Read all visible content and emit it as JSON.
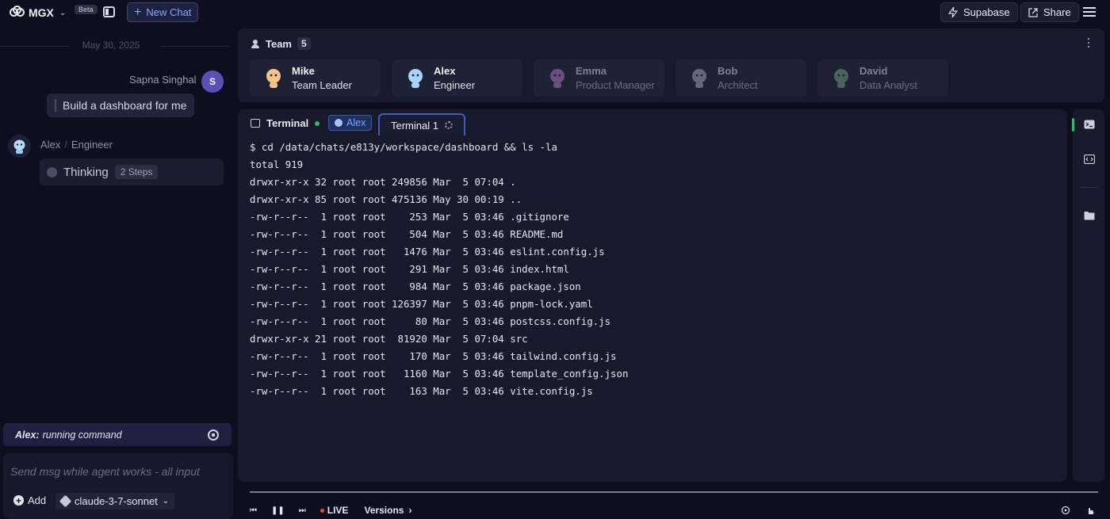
{
  "app": {
    "logo_text": "MGX",
    "beta_label": "Beta",
    "new_chat_label": "New Chat",
    "supabase_label": "Supabase",
    "share_label": "Share"
  },
  "chat": {
    "date": "May 30, 2025",
    "user": {
      "name": "Sapna Singhal",
      "avatar_initial": "S",
      "message": "Build a dashboard for me"
    },
    "agent": {
      "name": "Alex",
      "role": "Engineer",
      "thinking_label": "Thinking",
      "steps_label": "2 Steps"
    },
    "status": {
      "agent": "Alex:",
      "text": "running command"
    },
    "input": {
      "placeholder": "Send msg while agent works - all input",
      "add_label": "Add",
      "model": "claude-3-7-sonnet"
    }
  },
  "team": {
    "title": "Team",
    "count": "5",
    "members": [
      {
        "name": "Mike",
        "role": "Team Leader",
        "active": true,
        "avatar_color": "#f4c48a"
      },
      {
        "name": "Alex",
        "role": "Engineer",
        "active": true,
        "avatar_color": "#a8d4ff"
      },
      {
        "name": "Emma",
        "role": "Product Manager",
        "active": false,
        "avatar_color": "#c58ad8"
      },
      {
        "name": "Bob",
        "role": "Architect",
        "active": false,
        "avatar_color": "#b9bccc"
      },
      {
        "name": "David",
        "role": "Data Analyst",
        "active": false,
        "avatar_color": "#7fb68f"
      }
    ]
  },
  "terminal": {
    "label": "Terminal",
    "agent_chip": "Alex",
    "tab_label": "Terminal 1",
    "lines": [
      "$ cd /data/chats/e813y/workspace/dashboard && ls -la",
      "total 919",
      "drwxr-xr-x 32 root root 249856 Mar  5 07:04 .",
      "drwxr-xr-x 85 root root 475136 May 30 00:19 ..",
      "-rw-r--r--  1 root root    253 Mar  5 03:46 .gitignore",
      "-rw-r--r--  1 root root    504 Mar  5 03:46 README.md",
      "-rw-r--r--  1 root root   1476 Mar  5 03:46 eslint.config.js",
      "-rw-r--r--  1 root root    291 Mar  5 03:46 index.html",
      "-rw-r--r--  1 root root    984 Mar  5 03:46 package.json",
      "-rw-r--r--  1 root root 126397 Mar  5 03:46 pnpm-lock.yaml",
      "-rw-r--r--  1 root root     80 Mar  5 03:46 postcss.config.js",
      "drwxr-xr-x 21 root root  81920 Mar  5 07:04 src",
      "-rw-r--r--  1 root root    170 Mar  5 03:46 tailwind.config.js",
      "-rw-r--r--  1 root root   1160 Mar  5 03:46 template_config.json",
      "-rw-r--r--  1 root root    163 Mar  5 03:46 vite.config.js"
    ]
  },
  "rail": {
    "icons": [
      "terminal-icon",
      "code-icon",
      "folder-icon"
    ]
  },
  "playback": {
    "live_label": "LIVE",
    "versions_label": "Versions"
  }
}
